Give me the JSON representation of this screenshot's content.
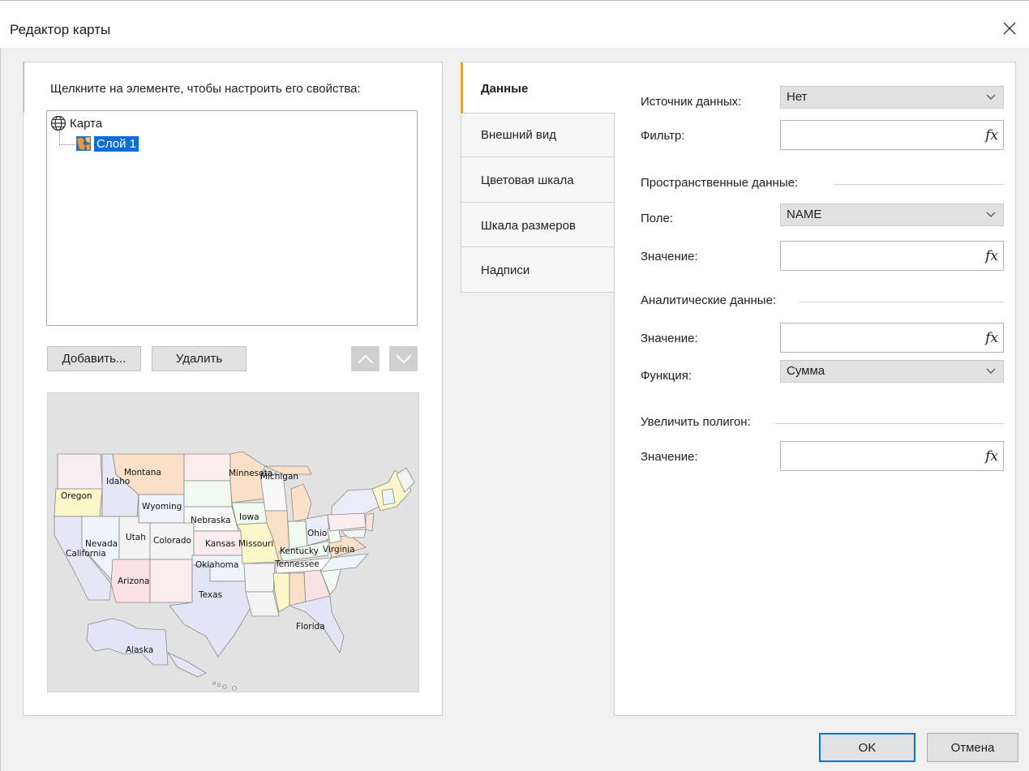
{
  "window": {
    "title": "Редактор карты"
  },
  "left": {
    "instruction": "Щелкните на элементе, чтобы настроить его свойства:",
    "tree": {
      "root_label": "Карта",
      "child_label": "Слой 1"
    },
    "add_label": "Добавить...",
    "delete_label": "Удалить",
    "map_labels": {
      "oregon": "Oregon",
      "idaho": "Idaho",
      "montana": "Montana",
      "wyoming": "Wyoming",
      "minnesota": "Minnesota",
      "michigan": "Michigan",
      "nebraska": "Nebraska",
      "iowa": "Iowa",
      "nevada": "Nevada",
      "california": "California",
      "utah": "Utah",
      "colorado": "Colorado",
      "kansas": "Kansas",
      "missouri": "Missouri",
      "ohio": "Ohio",
      "kentucky": "Kentucky",
      "virginia": "Virginia",
      "tennessee": "Tennessee",
      "oklahoma": "Oklahoma",
      "arizona": "Arizona",
      "texas": "Texas",
      "florida": "Florida",
      "alaska": "Alaska"
    }
  },
  "tabs": [
    "Данные",
    "Внешний вид",
    "Цветовая шкала",
    "Шкала размеров",
    "Надписи"
  ],
  "form": {
    "source_label": "Источник данных:",
    "source_value": "Нет",
    "filter_label": "Фильтр:",
    "spatial_section": "Пространственные данные:",
    "field_label": "Поле:",
    "field_value": "NAME",
    "value_label": "Значение:",
    "analytic_section": "Аналитические данные:",
    "analytic_value_label": "Значение:",
    "function_label": "Функция:",
    "function_value": "Сумма",
    "polygon_section": "Увеличить полигон:",
    "polygon_value_label": "Значение:",
    "fx_symbol": "fx"
  },
  "footer": {
    "ok_label": "OK",
    "cancel_label": "Отмена"
  },
  "colors": {
    "accent": "#e8a33a",
    "selection": "#0f6dd8",
    "ok_border": "#0078d7"
  }
}
